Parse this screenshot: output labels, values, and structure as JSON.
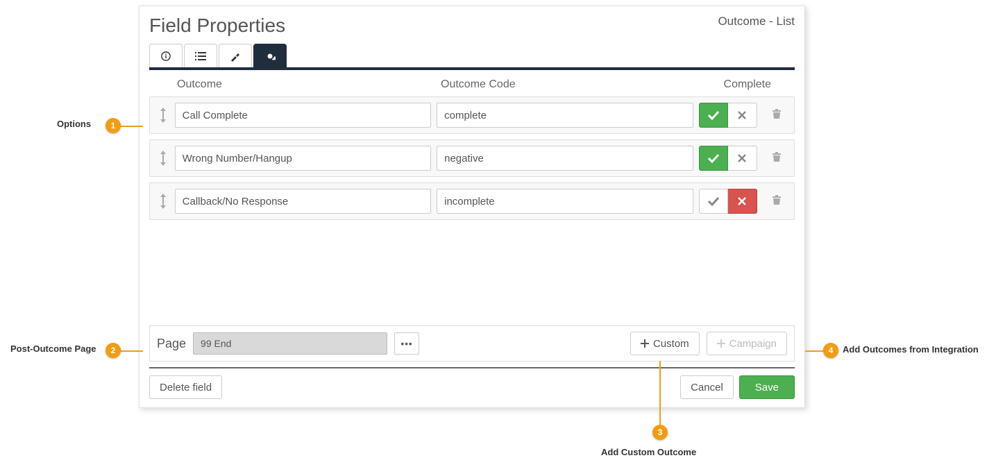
{
  "header": {
    "title": "Field Properties",
    "subtitle": "Outcome - List"
  },
  "columns": {
    "outcome": "Outcome",
    "code": "Outcome Code",
    "complete": "Complete"
  },
  "rows": [
    {
      "outcome": "Call Complete",
      "code": "complete",
      "complete": true
    },
    {
      "outcome": "Wrong Number/Hangup",
      "code": "negative",
      "complete": true
    },
    {
      "outcome": "Callback/No Response",
      "code": "incomplete",
      "complete": false
    }
  ],
  "page": {
    "label": "Page",
    "value": "99 End"
  },
  "buttons": {
    "custom": "Custom",
    "campaign": "Campaign",
    "delete": "Delete field",
    "cancel": "Cancel",
    "save": "Save",
    "more": "•••"
  },
  "callouts": {
    "c1": {
      "num": "1",
      "label": "Options"
    },
    "c2": {
      "num": "2",
      "label": "Post-Outcome Page"
    },
    "c3": {
      "num": "3",
      "label": "Add Custom Outcome"
    },
    "c4": {
      "num": "4",
      "label": "Add Outcomes from Integration"
    }
  }
}
